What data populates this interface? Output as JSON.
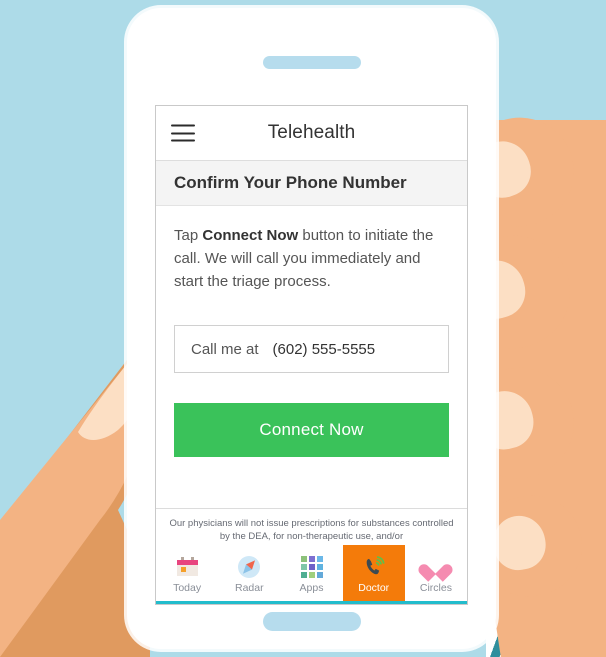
{
  "background": {
    "color": "#addbe8",
    "accent_yellow": "#f7b733",
    "stripe_teal": "#2f8f9d",
    "skin": "#f3b383",
    "nail": "#fcdfc4"
  },
  "device": {
    "frame_color": "#ffffff",
    "speaker_color": "#b6dced",
    "home_indicator_color": "#b6dced"
  },
  "screen": {
    "navbar": {
      "menu_icon": "hamburger-icon",
      "title": "Telehealth"
    },
    "subheader": {
      "title": "Confirm Your Phone Number"
    },
    "content": {
      "intro_prefix": "Tap ",
      "intro_bold": "Connect Now",
      "intro_suffix": " button to initiate the call. We will call you immediately and start the triage process.",
      "phone_field": {
        "label": "Call me at",
        "value": "(602) 555-5555",
        "placeholder": "(602) 555-5555"
      },
      "connect_button": {
        "label": "Connect Now",
        "color": "#3ac25a"
      }
    },
    "footer_note": "Our physicians will not issue prescriptions for substances controlled by the DEA, for non-therapeutic use, and/or",
    "tabbar": {
      "active_color": "#f47b0a",
      "underline_color": "#22bccc",
      "tabs": [
        {
          "label": "Today",
          "icon": "calendar-icon",
          "active": false
        },
        {
          "label": "Radar",
          "icon": "compass-icon",
          "active": false
        },
        {
          "label": "Apps",
          "icon": "apps-grid-icon",
          "active": false
        },
        {
          "label": "Doctor",
          "icon": "phone-call-icon",
          "active": true
        },
        {
          "label": "Circles",
          "icon": "heart-icon",
          "active": false
        }
      ],
      "apps_icon_colors": [
        "#8cc17a",
        "#7d6fd1",
        "#6bb8e8",
        "#7fc6a8",
        "#6f62c8",
        "#5fb3e0",
        "#4fae92",
        "#9fcf7e",
        "#63a9d9"
      ]
    }
  }
}
